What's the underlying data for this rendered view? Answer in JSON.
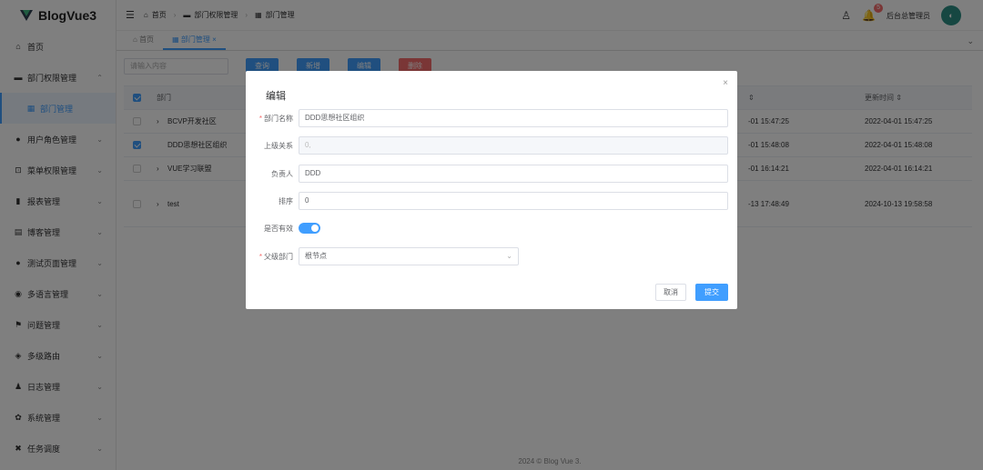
{
  "app": {
    "logo_text": "BlogVue3"
  },
  "sidebar": {
    "items": [
      {
        "icon": "home-icon",
        "glyph": "⌂",
        "label": "首页",
        "chevron": ""
      },
      {
        "icon": "department-icon",
        "glyph": "▬",
        "label": "部门权限管理",
        "chevron": "⌃"
      },
      {
        "icon": "grid-icon",
        "glyph": "▦",
        "label": "部门管理",
        "chevron": ""
      },
      {
        "icon": "user-icon",
        "glyph": "●",
        "label": "用户角色管理",
        "chevron": "⌄"
      },
      {
        "icon": "lock-icon",
        "glyph": "⊡",
        "label": "菜单权限管理",
        "chevron": "⌄"
      },
      {
        "icon": "chart-icon",
        "glyph": "▮",
        "label": "报表管理",
        "chevron": "⌄"
      },
      {
        "icon": "blog-icon",
        "glyph": "▤",
        "label": "博客管理",
        "chevron": "⌄"
      },
      {
        "icon": "test-icon",
        "glyph": "●",
        "label": "测试页面管理",
        "chevron": "⌄"
      },
      {
        "icon": "language-icon",
        "glyph": "◉",
        "label": "多语言管理",
        "chevron": "⌄"
      },
      {
        "icon": "flag-icon",
        "glyph": "⚑",
        "label": "问题管理",
        "chevron": "⌄"
      },
      {
        "icon": "route-icon",
        "glyph": "◈",
        "label": "多级路由",
        "chevron": "⌄"
      },
      {
        "icon": "log-icon",
        "glyph": "♟",
        "label": "日志管理",
        "chevron": "⌄"
      },
      {
        "icon": "settings-icon",
        "glyph": "✿",
        "label": "系统管理",
        "chevron": "⌄"
      },
      {
        "icon": "task-icon",
        "glyph": "✖",
        "label": "任务调度",
        "chevron": "⌄"
      }
    ]
  },
  "topbar": {
    "breadcrumb": [
      "首页",
      "部门权限管理",
      "部门管理"
    ],
    "notification_count": "5",
    "user_name": "后台总管理员"
  },
  "tabs": [
    {
      "label": "首页",
      "close": ""
    },
    {
      "label": "部门管理",
      "close": "×"
    }
  ],
  "toolbar": {
    "search_placeholder": "请输入内容",
    "query": "查询",
    "add": "新增",
    "edit": "编辑",
    "delete": "删除"
  },
  "table": {
    "col_dept": "部门",
    "col_created": "⇕",
    "col_updated": "更新时间 ⇕",
    "rows": [
      {
        "name": "BCVP开发社区",
        "prefix": "›",
        "checked": false,
        "created": "-01 15:47:25",
        "updated": "2022-04-01 15:47:25"
      },
      {
        "name": "DDD思想社区组织",
        "prefix": "",
        "checked": true,
        "created": "-01 15:48:08",
        "updated": "2022-04-01 15:48:08"
      },
      {
        "name": "VUE学习联盟",
        "prefix": "›",
        "checked": false,
        "created": "-01 16:14:21",
        "updated": "2022-04-01 16:14:21"
      },
      {
        "name": "test",
        "prefix": "›",
        "checked": false,
        "created": "-13 17:48:49",
        "updated": "2024-10-13 19:58:58"
      }
    ]
  },
  "footer": {
    "text": "2024 © Blog Vue 3."
  },
  "dialog": {
    "title": "编辑",
    "close": "×",
    "fields": {
      "dept_name_label": "部门名称",
      "dept_name_value": "DDD思想社区组织",
      "parent_rel_label": "上级关系",
      "parent_rel_value": "0,",
      "leader_label": "负责人",
      "leader_value": "DDD",
      "order_label": "排序",
      "order_value": "0",
      "enabled_label": "是否有效",
      "parent_dept_label": "父级部门",
      "parent_dept_value": "根节点"
    },
    "cancel": "取消",
    "submit": "提交"
  },
  "colors": {
    "primary": "#409eff",
    "danger": "#f56c6c",
    "mask": "rgba(0,0,0,0.5)"
  }
}
